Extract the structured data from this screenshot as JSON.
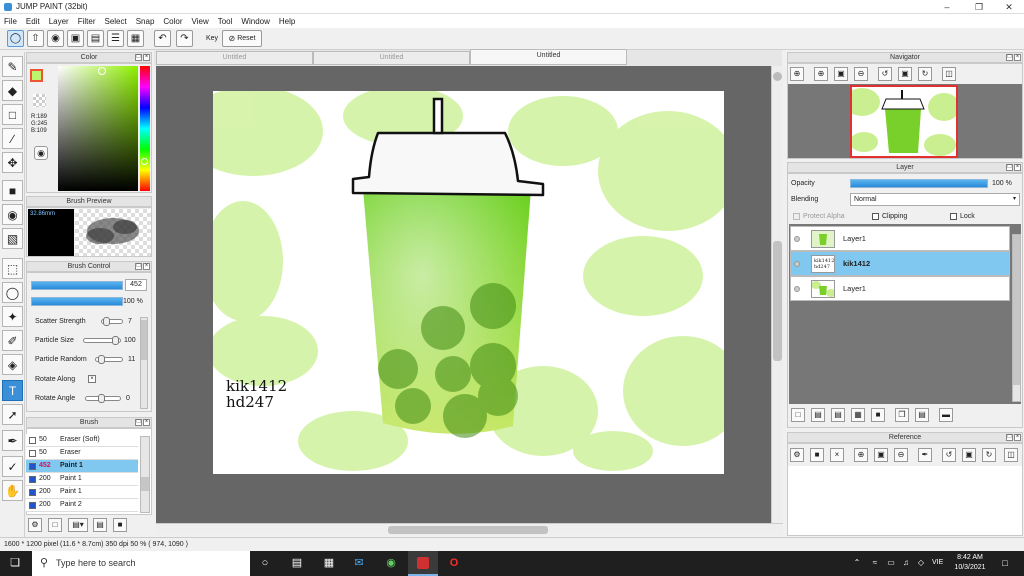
{
  "window": {
    "title": "JUMP PAINT (32bit)"
  },
  "menu": [
    "File",
    "Edit",
    "Layer",
    "Filter",
    "Select",
    "Snap",
    "Color",
    "View",
    "Tool",
    "Window",
    "Help"
  ],
  "toolbar": {
    "key_label": "Key",
    "reset_label": "Reset"
  },
  "tabs": [
    {
      "label": "Untitled",
      "active": false
    },
    {
      "label": "Untitled",
      "active": false
    },
    {
      "label": "Untitled",
      "active": true
    }
  ],
  "color_panel": {
    "title": "Color",
    "r": "R:189",
    "g": "G:245",
    "b": "B:109",
    "fg_color": "#bdf56d"
  },
  "brush_preview": {
    "title": "Brush Preview",
    "size": "32.86mm"
  },
  "brush_control": {
    "title": "Brush Control",
    "size_value": "452",
    "opacity_value": "100 %",
    "params": [
      {
        "label": "Scatter Strength",
        "value": "7"
      },
      {
        "label": "Particle Size",
        "value": "100"
      },
      {
        "label": "Particle Random",
        "value": "11"
      },
      {
        "label": "Rotate Along",
        "value": ""
      },
      {
        "label": "Rotate Angle",
        "value": "0"
      }
    ]
  },
  "brush_list": {
    "title": "Brush",
    "items": [
      {
        "size": "50",
        "name": "Eraser (Soft)",
        "color": "#ffffff",
        "selected": false
      },
      {
        "size": "50",
        "name": "Eraser",
        "color": "#ffffff",
        "selected": false
      },
      {
        "size": "452",
        "name": "Paint 1",
        "color": "#2255cc",
        "selected": true
      },
      {
        "size": "200",
        "name": "Paint 1",
        "color": "#2255cc",
        "selected": false
      },
      {
        "size": "200",
        "name": "Paint 1",
        "color": "#2255cc",
        "selected": false
      },
      {
        "size": "200",
        "name": "Paint 2",
        "color": "#2255cc",
        "selected": false
      }
    ]
  },
  "canvas": {
    "text_line1": "kik1412",
    "text_line2": "hd247"
  },
  "navigator": {
    "title": "Navigator"
  },
  "layer_panel": {
    "title": "Layer",
    "opacity_label": "Opacity",
    "opacity_value": "100 %",
    "blending_label": "Blending",
    "blending_value": "Normal",
    "protect_alpha": "Protect Alpha",
    "clipping": "Clipping",
    "lock": "Lock",
    "layers": [
      {
        "name": "Layer1",
        "selected": false,
        "thumb_text": ""
      },
      {
        "name": "kik1412",
        "selected": true,
        "thumb_text": "kik1412 hd247"
      },
      {
        "name": "Layer1",
        "selected": false,
        "thumb_text": ""
      }
    ]
  },
  "reference": {
    "title": "Reference"
  },
  "status": {
    "text": "1600 * 1200 pixel  (11.6 * 8.7cm)  350 dpi   50 %   ( 974, 1090 )"
  },
  "taskbar": {
    "search_placeholder": "Type here to search",
    "lang": "VIE",
    "time": "8:42 AM",
    "date": "10/3/2021"
  }
}
